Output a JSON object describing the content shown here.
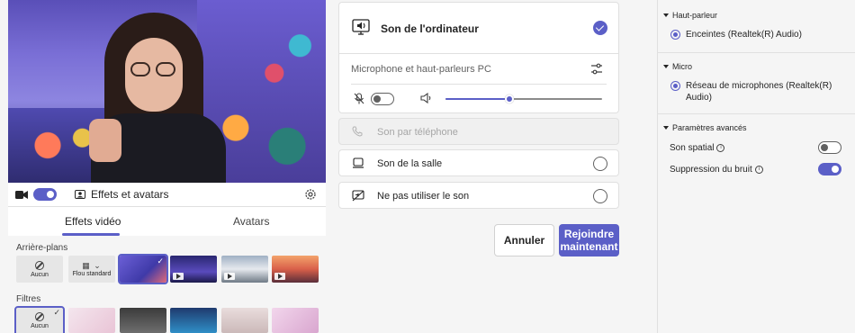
{
  "camera": {
    "effects_label": "Effets et avatars"
  },
  "tabs": {
    "video_effects": "Effets vidéo",
    "avatars": "Avatars"
  },
  "backgrounds": {
    "title": "Arrière-plans",
    "none_label": "Aucun",
    "blur_label": "Flou standard"
  },
  "filters": {
    "title": "Filtres",
    "none_label": "Aucun"
  },
  "audio_options": {
    "computer": "Son de l'ordinateur",
    "device": "Microphone et haut-parleurs PC",
    "phone": "Son par téléphone",
    "room": "Son de la salle",
    "no_audio": "Ne pas utiliser le son"
  },
  "volume": 0.41,
  "buttons": {
    "cancel": "Annuler",
    "join": "Rejoindre maintenant"
  },
  "settings": {
    "speaker_title": "Haut-parleur",
    "speaker_value": "Enceintes (Realtek(R) Audio)",
    "mic_title": "Micro",
    "mic_value": "Réseau de microphones (Realtek(R) Audio)",
    "advanced_title": "Paramètres avancés",
    "spatial_label": "Son spatial",
    "noise_label": "Suppression du bruit"
  },
  "colors": {
    "accent": "#5b5fc7"
  }
}
